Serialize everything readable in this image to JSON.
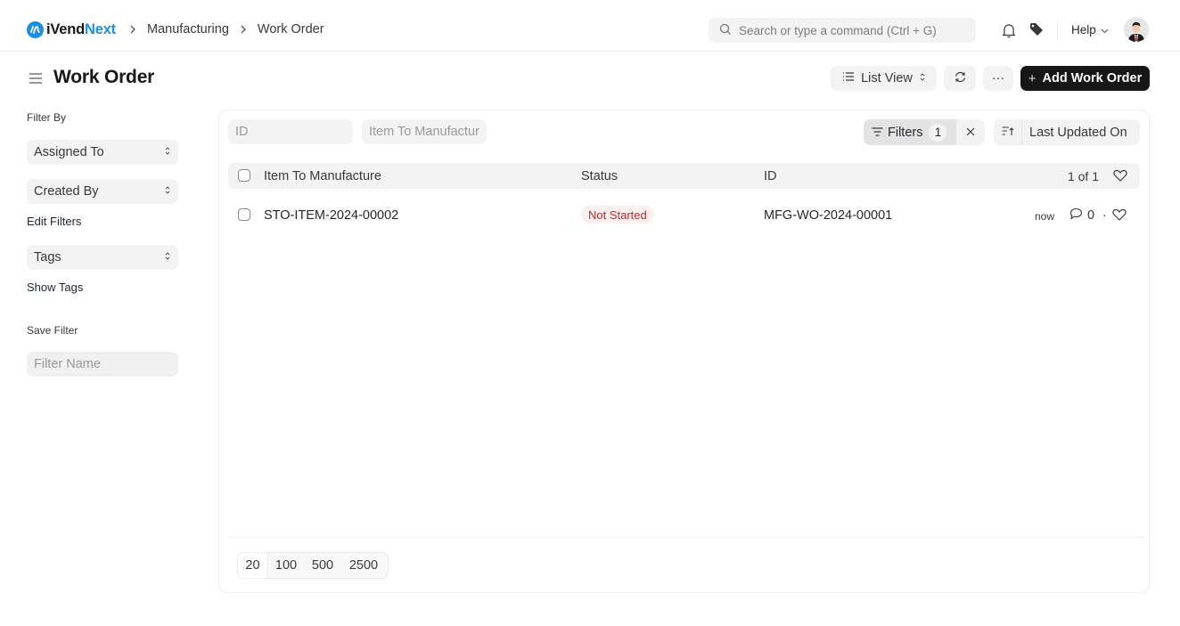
{
  "app": {
    "brand_prefix": "iVend",
    "brand_suffix": "Next",
    "brand_color": "#1a8fe3"
  },
  "breadcrumb": [
    {
      "label": "Manufacturing"
    },
    {
      "label": "Work Order"
    }
  ],
  "navbar": {
    "search_placeholder": "Search or type a command (Ctrl + G)",
    "help_label": "Help",
    "icons": [
      "search-icon",
      "bell-icon",
      "tag-icon",
      "chevron-down-icon",
      "user-avatar"
    ]
  },
  "page": {
    "title": "Work Order",
    "list_view_label": "List View",
    "more_label": "···",
    "add_button_label": "Add Work Order",
    "add_button_color": "#171717"
  },
  "sidebar": {
    "filter_by_label": "Filter By",
    "filters": [
      {
        "label": "Assigned To"
      },
      {
        "label": "Created By"
      }
    ],
    "edit_filters_label": "Edit Filters",
    "tags_label": "Tags",
    "show_tags_label": "Show Tags",
    "save_filter_label": "Save Filter",
    "filter_name_placeholder": "Filter Name"
  },
  "list": {
    "quick_filters": {
      "id_placeholder": "ID",
      "item_placeholder": "Item To Manufacture"
    },
    "filters_label": "Filters",
    "filter_count": "1",
    "sort_label": "Last Updated On",
    "columns": [
      "Item To Manufacture",
      "Status",
      "ID"
    ],
    "count_label": "1 of 1",
    "rows": [
      {
        "item": "STO-ITEM-2024-00002",
        "status": "Not Started",
        "status_color": "#c0262b",
        "id": "MFG-WO-2024-00001",
        "modified": "now",
        "comments": "0"
      }
    ],
    "page_sizes": [
      "20",
      "100",
      "500",
      "2500"
    ],
    "active_page_size": "20"
  }
}
